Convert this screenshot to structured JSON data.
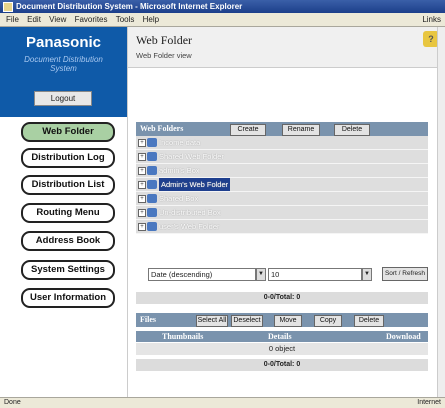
{
  "window": {
    "title": "Document Distribution System - Microsoft Internet Explorer"
  },
  "menubar": {
    "items": [
      "File",
      "Edit",
      "View",
      "Favorites",
      "Tools",
      "Help"
    ],
    "links": "Links"
  },
  "brand": {
    "logo": "Panasonic",
    "subtitle_1": "Document Distribution",
    "subtitle_2": "System",
    "logout": "Logout"
  },
  "nav": [
    {
      "label": "Web Folder",
      "active": true
    },
    {
      "label": "Distribution Log"
    },
    {
      "label": "Distribution List"
    },
    {
      "label": "Routing Menu"
    },
    {
      "label": "Address Book"
    },
    {
      "label": "System Settings"
    },
    {
      "label": "User Information"
    }
  ],
  "header": {
    "title": "Web Folder",
    "subtitle": "Web Folder view"
  },
  "web_folders": {
    "label": "Web Folders",
    "buttons": [
      "Create",
      "Rename",
      "Delete"
    ],
    "items": [
      {
        "name": "Income data"
      },
      {
        "name": "Shared Web Folder"
      },
      {
        "name": "admin's Box"
      },
      {
        "name": "Admin's Web Folder",
        "selected": true
      },
      {
        "name": "Shared Box"
      },
      {
        "name": "Un-distributed Box"
      },
      {
        "name": "user's Web Folder"
      }
    ]
  },
  "sort": {
    "order": "Date (descending)",
    "per_page": "10",
    "button": "Sort / Refresh"
  },
  "counts": {
    "folders": "0-0/Total: 0",
    "files": "0-0/Total: 0"
  },
  "files": {
    "label": "Files",
    "buttons": [
      "Select All",
      "Deselect",
      "Move",
      "Copy",
      "Delete"
    ],
    "columns": [
      "Thumbnails",
      "Details",
      "Download"
    ],
    "empty": "0 object"
  },
  "statusbar": {
    "left": "Done",
    "right": "Internet"
  }
}
